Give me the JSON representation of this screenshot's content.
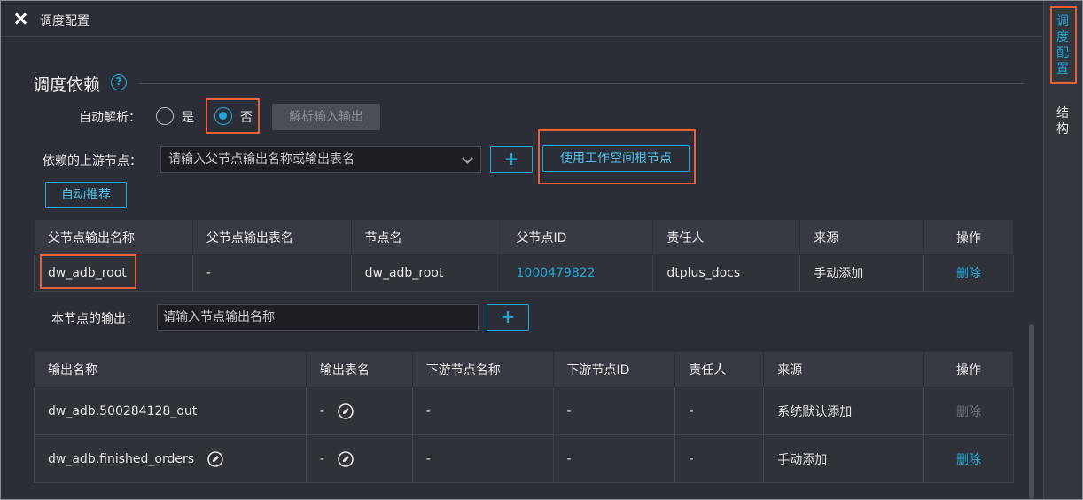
{
  "header": {
    "title": "调度配置"
  },
  "section": {
    "title": "调度依赖",
    "help": "?"
  },
  "auto_parse": {
    "label": "自动解析：",
    "options": [
      {
        "label": "是",
        "selected": false
      },
      {
        "label": "否",
        "selected": true
      }
    ],
    "parse_button": "解析输入输出"
  },
  "upstream": {
    "label": "依赖的上游节点：",
    "placeholder": "请输入父节点输出名称或输出表名",
    "add": "+",
    "root_button": "使用工作空间根节点",
    "recommend_button": "自动推荐"
  },
  "parent_table": {
    "headers": [
      "父节点输出名称",
      "父节点输出表名",
      "节点名",
      "父节点ID",
      "责任人",
      "来源",
      "操作"
    ],
    "rows": [
      [
        "dw_adb_root",
        "-",
        "dw_adb_root",
        "1000479822",
        "dtplus_docs",
        "手动添加",
        "删除"
      ]
    ]
  },
  "output": {
    "label": "本节点的输出：",
    "placeholder": "请输入节点输出名称",
    "add": "+"
  },
  "output_table": {
    "headers": [
      "输出名称",
      "输出表名",
      "下游节点名称",
      "下游节点ID",
      "责任人",
      "来源",
      "操作"
    ],
    "rows": [
      [
        "dw_adb.500284128_out",
        "-",
        "-",
        "-",
        "-",
        "系统默认添加",
        "删除"
      ],
      [
        "dw_adb.finished_orders",
        "-",
        "-",
        "-",
        "-",
        "手动添加",
        "删除"
      ]
    ]
  },
  "sidebar": {
    "tabs": [
      "调度配置",
      "结构"
    ]
  },
  "colors": {
    "accent": "#1fa7d6",
    "highlight": "#e5603a",
    "background": "#2b2e36"
  }
}
